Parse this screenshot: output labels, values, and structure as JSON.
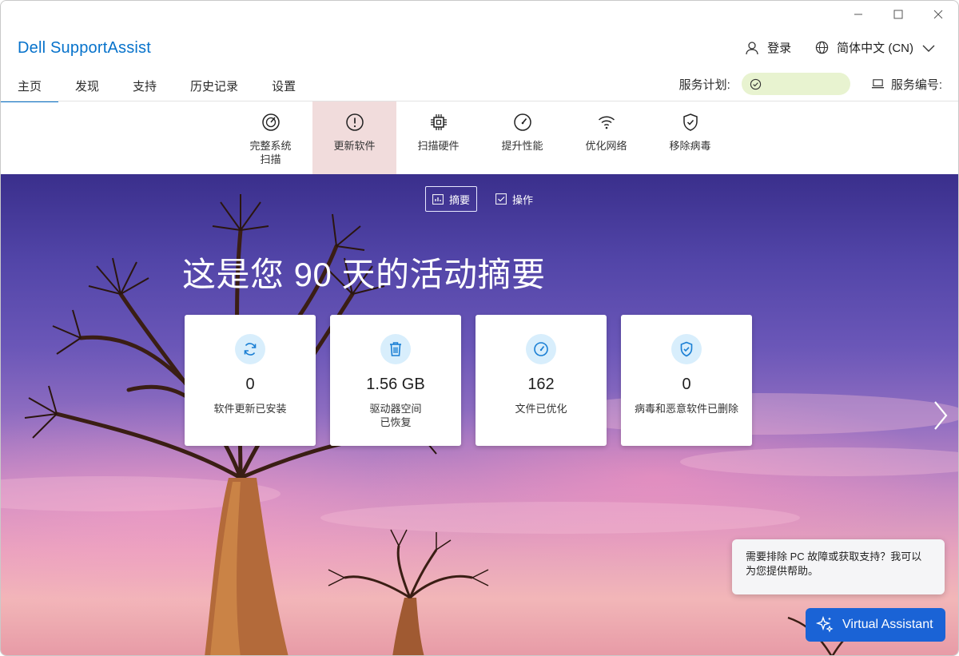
{
  "app": {
    "title": "Dell SupportAssist"
  },
  "header": {
    "login": "登录",
    "language": "简体中文 (CN)"
  },
  "nav": {
    "tabs": [
      {
        "label": "主页",
        "active": true
      },
      {
        "label": "发现"
      },
      {
        "label": "支持"
      },
      {
        "label": "历史记录"
      },
      {
        "label": "设置"
      }
    ],
    "service_plan_label": "服务计划:",
    "service_tag_label": "服务编号:"
  },
  "tools": [
    {
      "line1": "完整系统",
      "line2": "扫描",
      "icon": "scan-gauge-icon"
    },
    {
      "line1": "更新软件",
      "line2": "",
      "icon": "alert-circle-icon",
      "active": true
    },
    {
      "line1": "扫描硬件",
      "line2": "",
      "icon": "chip-icon"
    },
    {
      "line1": "提升性能",
      "line2": "",
      "icon": "speedometer-icon"
    },
    {
      "line1": "优化网络",
      "line2": "",
      "icon": "wifi-icon"
    },
    {
      "line1": "移除病毒",
      "line2": "",
      "icon": "shield-icon"
    }
  ],
  "hero": {
    "segments": [
      {
        "label": "摘要",
        "active": true
      },
      {
        "label": "操作"
      }
    ],
    "title": "这是您 90 天的活动摘要",
    "cards": [
      {
        "value": "0",
        "label_line1": "软件更新已安装",
        "label_line2": "",
        "icon": "refresh-icon"
      },
      {
        "value": "1.56 GB",
        "label_line1": "驱动器空间",
        "label_line2": "已恢复",
        "icon": "trash-icon"
      },
      {
        "value": "162",
        "label_line1": "文件已优化",
        "label_line2": "",
        "icon": "speedometer-icon"
      },
      {
        "value": "0",
        "label_line1": "病毒和恶意软件已删除",
        "label_line2": "",
        "icon": "shield-check-icon"
      }
    ]
  },
  "assistant": {
    "tip_text": "需要排除 PC 故障或获取支持？我可以为您提供帮助。",
    "button_label": "Virtual Assistant"
  },
  "colors": {
    "brand": "#0672cb",
    "active_tool_bg": "#f1dcdc",
    "plan_pill_bg": "#e8f3d0",
    "assistant_button": "#1a63d6"
  }
}
